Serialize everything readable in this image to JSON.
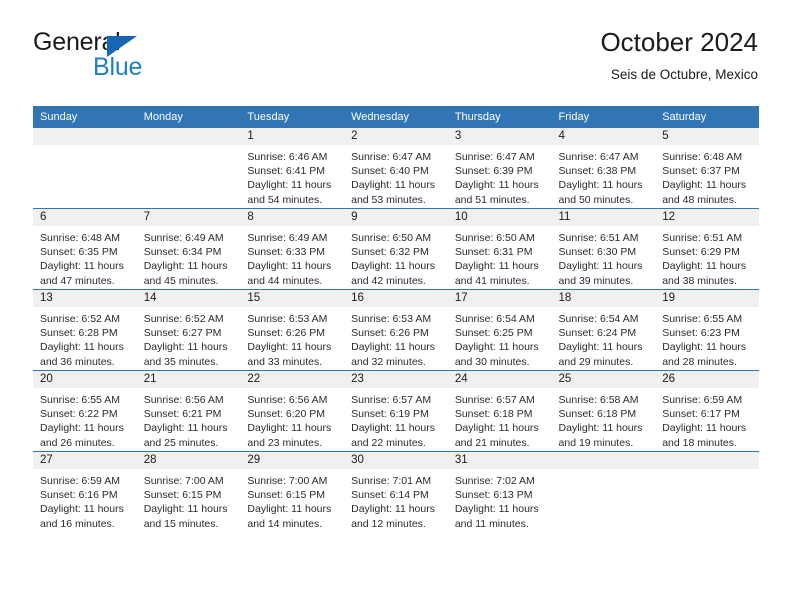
{
  "logo": {
    "word1": "General",
    "word2": "Blue",
    "triangle_color": "#1567b5",
    "word1_color": "#1b1b1b",
    "word2_color": "#1f7ec4"
  },
  "header": {
    "title": "October 2024",
    "subtitle": "Seis de Octubre, Mexico"
  },
  "colors": {
    "header_blue": "#3275b5",
    "daynum_band": "#f0f0f0",
    "text": "#2b2b2b"
  },
  "calendar": {
    "weekday_headers": [
      "Sunday",
      "Monday",
      "Tuesday",
      "Wednesday",
      "Thursday",
      "Friday",
      "Saturday"
    ],
    "weeks": [
      [
        {
          "day": "",
          "sunrise": "",
          "sunset": "",
          "daylight": "",
          "empty": true
        },
        {
          "day": "",
          "sunrise": "",
          "sunset": "",
          "daylight": "",
          "empty": true
        },
        {
          "day": "1",
          "sunrise": "Sunrise: 6:46 AM",
          "sunset": "Sunset: 6:41 PM",
          "daylight": "Daylight: 11 hours and 54 minutes."
        },
        {
          "day": "2",
          "sunrise": "Sunrise: 6:47 AM",
          "sunset": "Sunset: 6:40 PM",
          "daylight": "Daylight: 11 hours and 53 minutes."
        },
        {
          "day": "3",
          "sunrise": "Sunrise: 6:47 AM",
          "sunset": "Sunset: 6:39 PM",
          "daylight": "Daylight: 11 hours and 51 minutes."
        },
        {
          "day": "4",
          "sunrise": "Sunrise: 6:47 AM",
          "sunset": "Sunset: 6:38 PM",
          "daylight": "Daylight: 11 hours and 50 minutes."
        },
        {
          "day": "5",
          "sunrise": "Sunrise: 6:48 AM",
          "sunset": "Sunset: 6:37 PM",
          "daylight": "Daylight: 11 hours and 48 minutes."
        }
      ],
      [
        {
          "day": "6",
          "sunrise": "Sunrise: 6:48 AM",
          "sunset": "Sunset: 6:35 PM",
          "daylight": "Daylight: 11 hours and 47 minutes."
        },
        {
          "day": "7",
          "sunrise": "Sunrise: 6:49 AM",
          "sunset": "Sunset: 6:34 PM",
          "daylight": "Daylight: 11 hours and 45 minutes."
        },
        {
          "day": "8",
          "sunrise": "Sunrise: 6:49 AM",
          "sunset": "Sunset: 6:33 PM",
          "daylight": "Daylight: 11 hours and 44 minutes."
        },
        {
          "day": "9",
          "sunrise": "Sunrise: 6:50 AM",
          "sunset": "Sunset: 6:32 PM",
          "daylight": "Daylight: 11 hours and 42 minutes."
        },
        {
          "day": "10",
          "sunrise": "Sunrise: 6:50 AM",
          "sunset": "Sunset: 6:31 PM",
          "daylight": "Daylight: 11 hours and 41 minutes."
        },
        {
          "day": "11",
          "sunrise": "Sunrise: 6:51 AM",
          "sunset": "Sunset: 6:30 PM",
          "daylight": "Daylight: 11 hours and 39 minutes."
        },
        {
          "day": "12",
          "sunrise": "Sunrise: 6:51 AM",
          "sunset": "Sunset: 6:29 PM",
          "daylight": "Daylight: 11 hours and 38 minutes."
        }
      ],
      [
        {
          "day": "13",
          "sunrise": "Sunrise: 6:52 AM",
          "sunset": "Sunset: 6:28 PM",
          "daylight": "Daylight: 11 hours and 36 minutes."
        },
        {
          "day": "14",
          "sunrise": "Sunrise: 6:52 AM",
          "sunset": "Sunset: 6:27 PM",
          "daylight": "Daylight: 11 hours and 35 minutes."
        },
        {
          "day": "15",
          "sunrise": "Sunrise: 6:53 AM",
          "sunset": "Sunset: 6:26 PM",
          "daylight": "Daylight: 11 hours and 33 minutes."
        },
        {
          "day": "16",
          "sunrise": "Sunrise: 6:53 AM",
          "sunset": "Sunset: 6:26 PM",
          "daylight": "Daylight: 11 hours and 32 minutes."
        },
        {
          "day": "17",
          "sunrise": "Sunrise: 6:54 AM",
          "sunset": "Sunset: 6:25 PM",
          "daylight": "Daylight: 11 hours and 30 minutes."
        },
        {
          "day": "18",
          "sunrise": "Sunrise: 6:54 AM",
          "sunset": "Sunset: 6:24 PM",
          "daylight": "Daylight: 11 hours and 29 minutes."
        },
        {
          "day": "19",
          "sunrise": "Sunrise: 6:55 AM",
          "sunset": "Sunset: 6:23 PM",
          "daylight": "Daylight: 11 hours and 28 minutes."
        }
      ],
      [
        {
          "day": "20",
          "sunrise": "Sunrise: 6:55 AM",
          "sunset": "Sunset: 6:22 PM",
          "daylight": "Daylight: 11 hours and 26 minutes."
        },
        {
          "day": "21",
          "sunrise": "Sunrise: 6:56 AM",
          "sunset": "Sunset: 6:21 PM",
          "daylight": "Daylight: 11 hours and 25 minutes."
        },
        {
          "day": "22",
          "sunrise": "Sunrise: 6:56 AM",
          "sunset": "Sunset: 6:20 PM",
          "daylight": "Daylight: 11 hours and 23 minutes."
        },
        {
          "day": "23",
          "sunrise": "Sunrise: 6:57 AM",
          "sunset": "Sunset: 6:19 PM",
          "daylight": "Daylight: 11 hours and 22 minutes."
        },
        {
          "day": "24",
          "sunrise": "Sunrise: 6:57 AM",
          "sunset": "Sunset: 6:18 PM",
          "daylight": "Daylight: 11 hours and 21 minutes."
        },
        {
          "day": "25",
          "sunrise": "Sunrise: 6:58 AM",
          "sunset": "Sunset: 6:18 PM",
          "daylight": "Daylight: 11 hours and 19 minutes."
        },
        {
          "day": "26",
          "sunrise": "Sunrise: 6:59 AM",
          "sunset": "Sunset: 6:17 PM",
          "daylight": "Daylight: 11 hours and 18 minutes."
        }
      ],
      [
        {
          "day": "27",
          "sunrise": "Sunrise: 6:59 AM",
          "sunset": "Sunset: 6:16 PM",
          "daylight": "Daylight: 11 hours and 16 minutes."
        },
        {
          "day": "28",
          "sunrise": "Sunrise: 7:00 AM",
          "sunset": "Sunset: 6:15 PM",
          "daylight": "Daylight: 11 hours and 15 minutes."
        },
        {
          "day": "29",
          "sunrise": "Sunrise: 7:00 AM",
          "sunset": "Sunset: 6:15 PM",
          "daylight": "Daylight: 11 hours and 14 minutes."
        },
        {
          "day": "30",
          "sunrise": "Sunrise: 7:01 AM",
          "sunset": "Sunset: 6:14 PM",
          "daylight": "Daylight: 11 hours and 12 minutes."
        },
        {
          "day": "31",
          "sunrise": "Sunrise: 7:02 AM",
          "sunset": "Sunset: 6:13 PM",
          "daylight": "Daylight: 11 hours and 11 minutes."
        },
        {
          "day": "",
          "sunrise": "",
          "sunset": "",
          "daylight": "",
          "empty": true
        },
        {
          "day": "",
          "sunrise": "",
          "sunset": "",
          "daylight": "",
          "empty": true
        }
      ]
    ]
  }
}
